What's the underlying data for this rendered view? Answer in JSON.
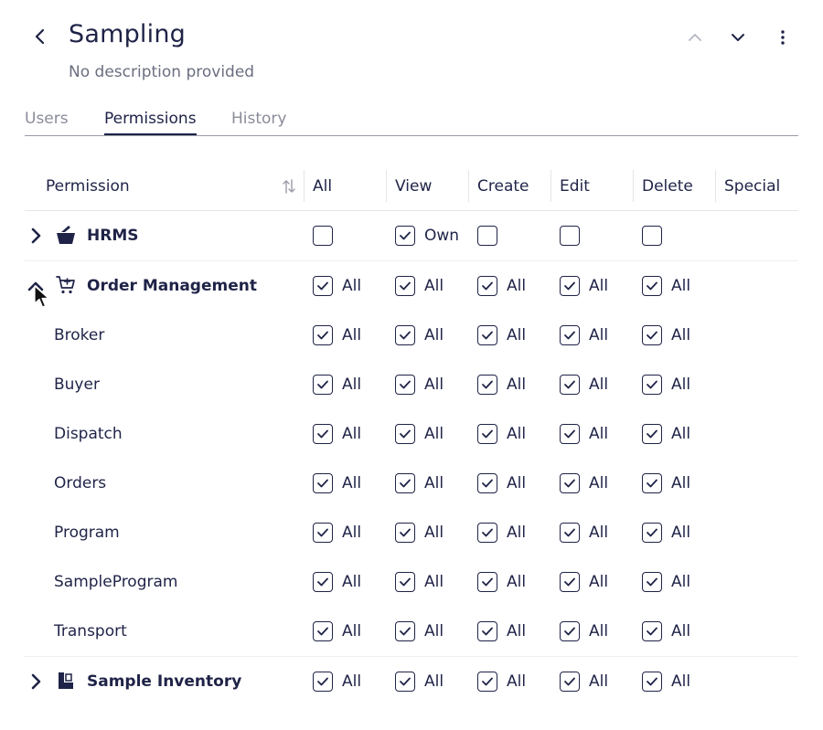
{
  "header": {
    "title": "Sampling",
    "subtitle": "No description provided"
  },
  "tabs": [
    {
      "label": "Users",
      "active": false
    },
    {
      "label": "Permissions",
      "active": true
    },
    {
      "label": "History",
      "active": false
    }
  ],
  "columns": {
    "permission": "Permission",
    "all": "All",
    "view": "View",
    "create": "Create",
    "edit": "Edit",
    "delete": "Delete",
    "special": "Special"
  },
  "icons": {
    "back": "chevron-left-icon",
    "prev": "chevron-up-icon",
    "next": "chevron-down-icon",
    "more": "more-vertical-icon",
    "sort": "sort-icon",
    "hrms": "hrms-icon",
    "order_management": "cart-icon",
    "sample_inventory": "inventory-icon"
  },
  "rows": {
    "hrms": {
      "label": "HRMS",
      "expanded": false,
      "all": {
        "checked": false,
        "label": ""
      },
      "view": {
        "checked": true,
        "label": "Own"
      },
      "create": {
        "checked": false,
        "label": ""
      },
      "edit": {
        "checked": false,
        "label": ""
      },
      "delete": {
        "checked": false,
        "label": ""
      }
    },
    "order_management": {
      "label": "Order Management",
      "expanded": true,
      "cell_label": "All",
      "children": [
        {
          "label": "Broker"
        },
        {
          "label": "Buyer"
        },
        {
          "label": "Dispatch"
        },
        {
          "label": "Orders"
        },
        {
          "label": "Program"
        },
        {
          "label": "SampleProgram"
        },
        {
          "label": "Transport"
        }
      ]
    },
    "sample_inventory": {
      "label": "Sample Inventory",
      "expanded": false,
      "cell_label": "All"
    }
  },
  "colors": {
    "text": "#1f2347",
    "muted": "#8a8c99",
    "border": "#e4e5ea"
  }
}
